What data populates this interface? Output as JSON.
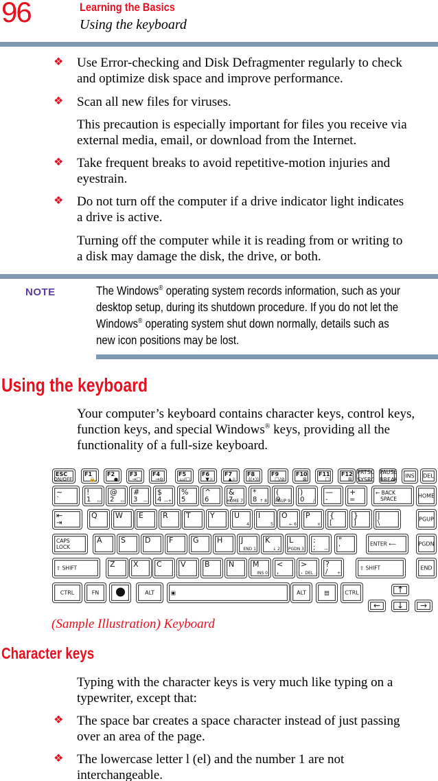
{
  "header": {
    "page_number": "96",
    "chapter": "Learning the Basics",
    "section": "Using the keyboard"
  },
  "bullets_top": [
    {
      "icon": "diamond-bullet-icon",
      "lines": [
        "Use Error-checking and Disk Defragmenter regularly to check",
        "and optimize disk space and improve performance."
      ]
    },
    {
      "icon": "diamond-bullet-icon",
      "lines": [
        "Scan all new files for viruses."
      ]
    },
    {
      "icon": null,
      "lines": [
        "This precaution is especially important for files you receive via",
        "external media, email, or download from the Internet."
      ]
    },
    {
      "icon": "diamond-bullet-icon",
      "lines": [
        "Take frequent breaks to avoid repetitive-motion injuries and",
        "eyestrain."
      ]
    },
    {
      "icon": "diamond-bullet-icon",
      "lines": [
        "Do not turn off the computer if a drive indicator light indicates",
        "a drive is active."
      ]
    },
    {
      "icon": null,
      "lines": [
        "Turning off the computer while it is reading from or writing to",
        "a disk may damage the disk, the drive, or both."
      ]
    }
  ],
  "bullet_glyph": "❖",
  "note": {
    "label": "NOTE",
    "lines": [
      "The Windows® operating system records information, such as your",
      "desktop setup, during its shutdown procedure. If you do not let the",
      "Windows® operating system shut down normally, details such as",
      "new icon positions may be lost."
    ]
  },
  "section_keyboard": {
    "heading": "Using the keyboard",
    "intro_lines": [
      "Your computer’s keyboard contains character keys, control keys,",
      "function keys, and special Windows® keys, providing all the",
      "functionality of a full-size keyboard."
    ],
    "caption": "(Sample Illustration) Keyboard"
  },
  "keyboard": {
    "rows": [
      {
        "name": "function-row",
        "keys": [
          {
            "id": "esc",
            "main": "ESC",
            "aux": "ON/OFF",
            "type": "fn"
          },
          {
            "id": "f1",
            "main": "F1",
            "aux": "🔒",
            "type": "fn"
          },
          {
            "id": "f2",
            "main": "F2",
            "aux": "●",
            "type": "fn"
          },
          {
            "id": "f3",
            "main": "F3",
            "aux": "→□",
            "type": "fn"
          },
          {
            "id": "f4",
            "main": "F4",
            "aux": "→⊖",
            "type": "fn"
          },
          {
            "id": "f5",
            "main": "F5",
            "aux": "▭/□",
            "type": "fn"
          },
          {
            "id": "f6",
            "main": "F6",
            "aux": "▼☼",
            "type": "fn"
          },
          {
            "id": "f7",
            "main": "F7",
            "aux": "▲☼",
            "type": "fn"
          },
          {
            "id": "f8",
            "main": "F8",
            "aux": "((•))",
            "type": "fn"
          },
          {
            "id": "f9",
            "main": "F9",
            "aux": "□/⊘",
            "type": "fn"
          },
          {
            "id": "f10",
            "main": "F10",
            "aux": "⊠",
            "type": "fn"
          },
          {
            "id": "f11",
            "main": "F11",
            "aux": "□",
            "type": "fn"
          },
          {
            "id": "f12",
            "main": "F12",
            "aux": "⊞",
            "type": "fn"
          },
          {
            "id": "prtsc",
            "main": "PRTSC\nSYSRQ",
            "type": "center"
          },
          {
            "id": "pause",
            "main": "PAUSE\nBREAK",
            "type": "center"
          },
          {
            "id": "ins",
            "main": "INS",
            "type": "center"
          },
          {
            "id": "del",
            "main": "DEL",
            "type": "center"
          }
        ]
      },
      {
        "name": "number-row",
        "keys": [
          {
            "id": "tilde",
            "main": "~",
            "sub": "`"
          },
          {
            "id": "1",
            "main": "!",
            "sub": "1",
            "aux": "▭"
          },
          {
            "id": "2",
            "main": "@",
            "sub": "2",
            "aux": "▭"
          },
          {
            "id": "3",
            "main": "#",
            "sub": "3",
            "aux": "—"
          },
          {
            "id": "4",
            "main": "$",
            "sub": "4",
            "aux": "—+"
          },
          {
            "id": "5",
            "main": "%",
            "sub": "5"
          },
          {
            "id": "6",
            "main": "^",
            "sub": "6"
          },
          {
            "id": "7",
            "main": "&",
            "sub": "7",
            "aux": "HOME 7"
          },
          {
            "id": "8",
            "main": "*",
            "sub": "8",
            "aux": "↑ 8"
          },
          {
            "id": "9",
            "main": "(",
            "sub": "9",
            "aux": "PGUP 9"
          },
          {
            "id": "0",
            "main": ")",
            "sub": "0",
            "aux": "/"
          },
          {
            "id": "minus",
            "main": "—",
            "sub": "-"
          },
          {
            "id": "equals",
            "main": "+",
            "sub": "="
          },
          {
            "id": "backspace",
            "main": "← BACK\n   SPACE",
            "type": "word"
          },
          {
            "id": "home",
            "main": "HOME",
            "type": "center"
          }
        ]
      },
      {
        "name": "qwerty-row",
        "keys": [
          {
            "id": "tab",
            "main": "⇤",
            "sub": "⇥"
          },
          {
            "id": "q",
            "main": "Q"
          },
          {
            "id": "w",
            "main": "W"
          },
          {
            "id": "e",
            "main": "E"
          },
          {
            "id": "r",
            "main": "R"
          },
          {
            "id": "t",
            "main": "T"
          },
          {
            "id": "y",
            "main": "Y"
          },
          {
            "id": "u",
            "main": "U",
            "aux": "4"
          },
          {
            "id": "i",
            "main": "I",
            "aux": "5"
          },
          {
            "id": "o",
            "main": "O",
            "aux": "← 6"
          },
          {
            "id": "p",
            "main": "P",
            "aux": "×"
          },
          {
            "id": "lbracket",
            "main": "{",
            "sub": "["
          },
          {
            "id": "rbracket",
            "main": "}",
            "sub": "]"
          },
          {
            "id": "backslash",
            "main": "|",
            "sub": "\\"
          },
          {
            "id": "pgup",
            "main": "PGUP",
            "type": "center"
          }
        ]
      },
      {
        "name": "home-row",
        "keys": [
          {
            "id": "capslock",
            "main": "CAPS\nLOCK",
            "type": "word"
          },
          {
            "id": "a",
            "main": "A"
          },
          {
            "id": "s",
            "main": "S"
          },
          {
            "id": "d",
            "main": "D"
          },
          {
            "id": "f",
            "main": "F"
          },
          {
            "id": "g",
            "main": "G"
          },
          {
            "id": "h",
            "main": "H"
          },
          {
            "id": "j",
            "main": "J",
            "aux": "END 1"
          },
          {
            "id": "k",
            "main": "K",
            "aux": "↓ 2"
          },
          {
            "id": "l",
            "main": "L",
            "aux": "PGDN 3"
          },
          {
            "id": "semicolon",
            "main": ":",
            "sub": ";",
            "aux": "—"
          },
          {
            "id": "quote",
            "main": "\"",
            "sub": "'"
          },
          {
            "id": "enter",
            "main": "ENTER ⟵",
            "type": "word"
          },
          {
            "id": "pgdn",
            "main": "PGDN",
            "type": "center"
          }
        ]
      },
      {
        "name": "shift-row",
        "keys": [
          {
            "id": "lshift",
            "main": "⇧ SHIFT",
            "type": "word"
          },
          {
            "id": "z",
            "main": "Z"
          },
          {
            "id": "x",
            "main": "X"
          },
          {
            "id": "c",
            "main": "C"
          },
          {
            "id": "v",
            "main": "V"
          },
          {
            "id": "b",
            "main": "B"
          },
          {
            "id": "n",
            "main": "N"
          },
          {
            "id": "m",
            "main": "M",
            "aux": "INS 0"
          },
          {
            "id": "comma",
            "main": "<",
            "sub": ","
          },
          {
            "id": "period",
            "main": ">",
            "sub": ".",
            "aux": "DEL ."
          },
          {
            "id": "slash",
            "main": "?",
            "sub": "/",
            "aux": "+"
          },
          {
            "id": "rshift",
            "main": "⇧ SHIFT",
            "type": "word"
          },
          {
            "id": "end",
            "main": "END",
            "type": "center"
          }
        ]
      },
      {
        "name": "bottom-row",
        "keys": [
          {
            "id": "lctrl",
            "main": "CTRL",
            "type": "center"
          },
          {
            "id": "fnkey",
            "main": "FN",
            "type": "center"
          },
          {
            "id": "winkey",
            "main": "",
            "type": "win"
          },
          {
            "id": "lalt",
            "main": "ALT",
            "type": "center"
          },
          {
            "id": "space",
            "main": "▣",
            "type": "word"
          },
          {
            "id": "ralt",
            "main": "ALT",
            "type": "center"
          },
          {
            "id": "appkey",
            "main": "▤",
            "type": "center"
          },
          {
            "id": "rctrl",
            "main": "CTRL",
            "type": "center"
          },
          {
            "id": "up",
            "main": "↑",
            "type": "arrow"
          },
          {
            "id": "left",
            "main": "←",
            "type": "arrow"
          },
          {
            "id": "down",
            "main": "↓",
            "type": "arrow"
          },
          {
            "id": "right",
            "main": "→",
            "type": "arrow"
          }
        ]
      }
    ]
  },
  "section_character_keys": {
    "heading": "Character keys",
    "intro_lines": [
      "Typing with the character keys is very much like typing on a",
      "typewriter, except that:"
    ],
    "bullets": [
      {
        "icon": "diamond-bullet-icon",
        "lines": [
          "The space bar creates a space character instead of just passing",
          "over an area of the page."
        ]
      },
      {
        "icon": "diamond-bullet-icon",
        "lines": [
          "The lowercase letter l (el) and the number 1 are not",
          "interchangeable."
        ]
      }
    ]
  },
  "colors": {
    "accent_red": "#e8101e",
    "rule_blue_gray": "#7f99b2",
    "note_purple": "#5b3c9e"
  }
}
